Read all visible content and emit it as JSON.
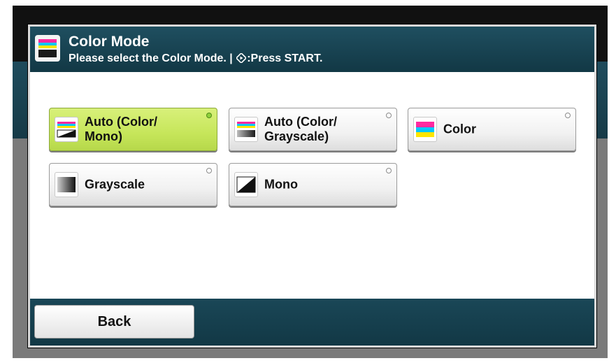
{
  "header": {
    "title": "Color Mode",
    "subtitle_prefix": "Please select the Color Mode. | ",
    "subtitle_suffix": ":Press START.",
    "icon": "color-mode-icon"
  },
  "options": [
    {
      "label": "Auto (Color/\nMono)",
      "icon": "auto-color-mono-icon",
      "selected": true
    },
    {
      "label": "Auto (Color/\nGrayscale)",
      "icon": "auto-color-grayscale-icon",
      "selected": false
    },
    {
      "label": "Color",
      "icon": "color-icon",
      "selected": false
    },
    {
      "label": "Grayscale",
      "icon": "grayscale-icon",
      "selected": false
    },
    {
      "label": "Mono",
      "icon": "mono-icon",
      "selected": false
    }
  ],
  "footer": {
    "back_label": "Back"
  },
  "colors": {
    "title_bar": "#1f4f60",
    "selected_option": "#c6e65a",
    "selected_indicator": "#8fd13a"
  }
}
